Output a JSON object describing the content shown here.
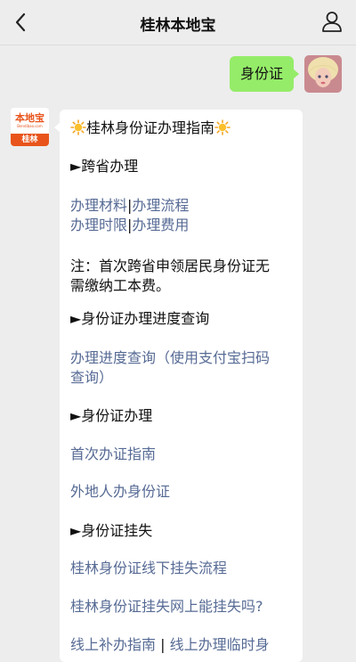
{
  "header": {
    "title": "桂林本地宝"
  },
  "chat": {
    "outgoing_text": "身份证",
    "bot_avatar": {
      "logo": "本地宝",
      "domain": "Bendibao.com",
      "city": "桂林"
    },
    "card": {
      "heading": "桂林身份证办理指南",
      "s1_title": "►跨省办理",
      "links1": [
        "办理材料",
        "办理流程",
        "办理时限",
        "办理费用"
      ],
      "divider": "|",
      "note_1": "注：首次跨省申领居民身份证无",
      "note_2": "需缴纳工本费。",
      "s2_title": "►身份证办理进度查询",
      "progress_1": "办理进度查询（使用支付宝扫码",
      "progress_2": "查询）",
      "s3_title": "►身份证办理",
      "first_guide": "首次办证指南",
      "outsider": "外地人办身份证",
      "s4_title": "►身份证挂失",
      "lost_offline": "桂林身份证线下挂失流程",
      "lost_online": "桂林身份证挂失网上能挂失吗?",
      "partial_1": "线上补办指南",
      "partial_2": "线上办理临时身"
    }
  },
  "colors": {
    "link": "#576b95",
    "outgoing_bubble": "#95ec69",
    "brand_orange": "#e8541b"
  }
}
